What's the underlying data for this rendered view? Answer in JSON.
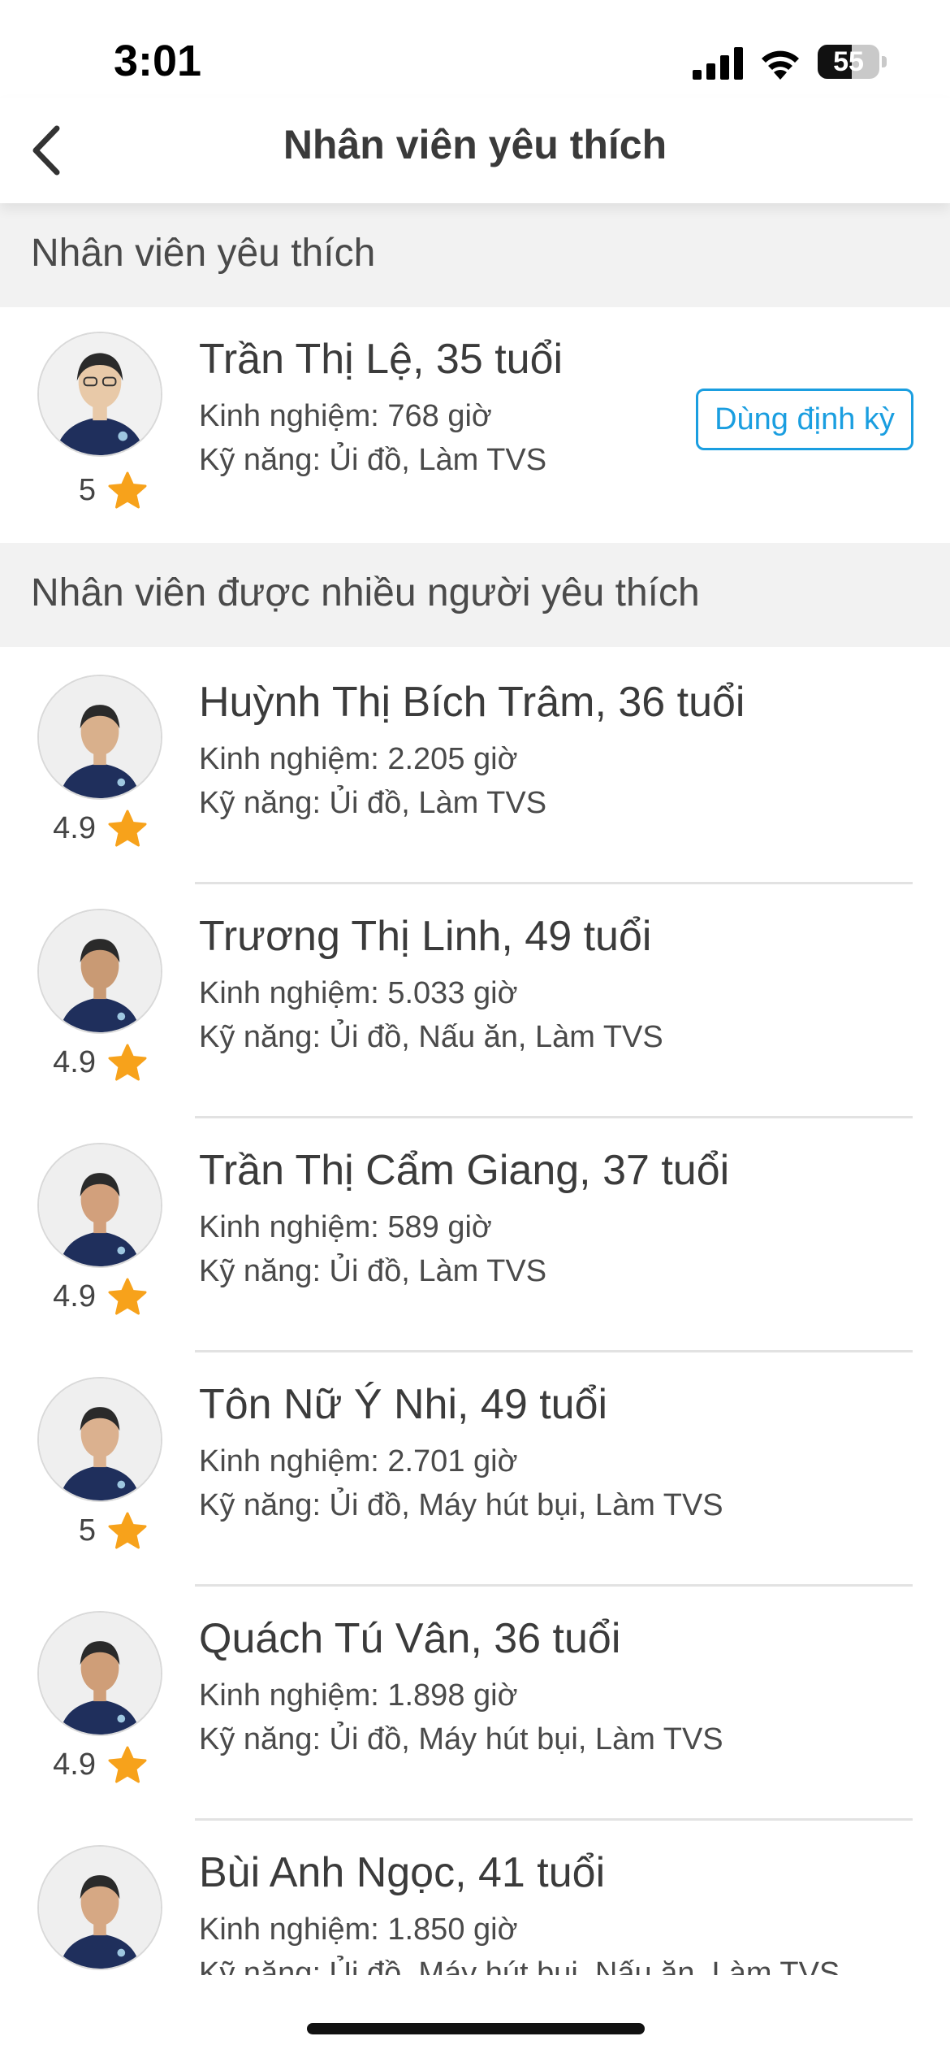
{
  "status_bar": {
    "time": "3:01",
    "battery_label": "55",
    "battery_level_percent": 55
  },
  "nav": {
    "title": "Nhân viên yêu thích",
    "back_icon": "chevron-left-icon"
  },
  "favorites_section": {
    "title": "Nhân viên yêu thích",
    "items": [
      {
        "name": "Trần Thị Lệ, 35 tuổi",
        "experience": "Kinh nghiệm: 768 giờ",
        "skills": "Kỹ năng: Ủi đồ, Làm TVS",
        "rating": "5",
        "action_label": "Dùng định kỳ"
      }
    ]
  },
  "popular_section": {
    "title": "Nhân viên được nhiều người yêu thích",
    "items": [
      {
        "name": "Huỳnh Thị Bích Trâm, 36 tuổi",
        "experience": "Kinh nghiệm: 2.205 giờ",
        "skills": "Kỹ năng: Ủi đồ, Làm TVS",
        "rating": "4.9"
      },
      {
        "name": "Trương Thị Linh, 49 tuổi",
        "experience": "Kinh nghiệm: 5.033 giờ",
        "skills": "Kỹ năng: Ủi đồ, Nấu ăn, Làm TVS",
        "rating": "4.9"
      },
      {
        "name": "Trần Thị Cẩm Giang, 37 tuổi",
        "experience": "Kinh nghiệm: 589 giờ",
        "skills": "Kỹ năng: Ủi đồ, Làm TVS",
        "rating": "4.9"
      },
      {
        "name": "Tôn Nữ Ý Nhi, 49 tuổi",
        "experience": "Kinh nghiệm: 2.701 giờ",
        "skills": "Kỹ năng: Ủi đồ, Máy hút bụi, Làm TVS",
        "rating": "5"
      },
      {
        "name": "Quách Tú Vân, 36 tuổi",
        "experience": "Kinh nghiệm: 1.898 giờ",
        "skills": "Kỹ năng: Ủi đồ, Máy hút bụi, Làm TVS",
        "rating": "4.9"
      },
      {
        "name": "Bùi Anh Ngọc, 41 tuổi",
        "experience": "Kinh nghiệm: 1.850 giờ",
        "skills": "Kỹ năng: Ủi đồ, Máy hút bụi, Nấu ăn, Làm TVS",
        "rating": ""
      }
    ]
  },
  "colors": {
    "accent": "#1a9ee0",
    "star": "#f7a21b",
    "section_bg": "#f2f2f2",
    "uniform": "#1f2f5c"
  }
}
